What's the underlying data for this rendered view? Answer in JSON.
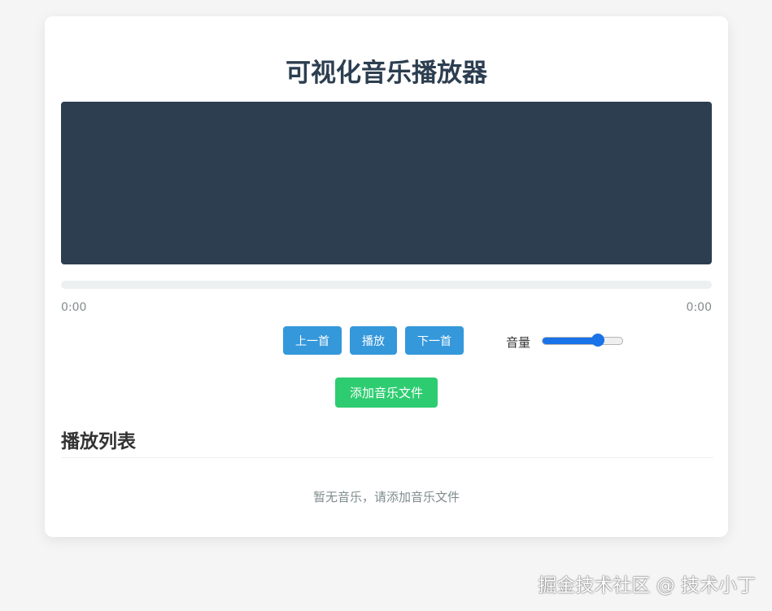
{
  "app": {
    "title": "可视化音乐播放器"
  },
  "player": {
    "progress_fraction": 0,
    "current_time": "0:00",
    "total_time": "0:00",
    "prev_label": "上一首",
    "play_label": "播放",
    "next_label": "下一首",
    "volume_label": "音量",
    "volume_value": 0.7
  },
  "actions": {
    "add_music_label": "添加音乐文件"
  },
  "playlist": {
    "heading": "播放列表",
    "empty_message": "暂无音乐，请添加音乐文件",
    "items": []
  },
  "watermark": {
    "text": "掘金技术社区 @ 技术小丁"
  },
  "colors": {
    "primary": "#3498db",
    "success": "#2ecc71",
    "visualizer_bg": "#2c3e50",
    "slider_accent": "#1a73e8"
  }
}
